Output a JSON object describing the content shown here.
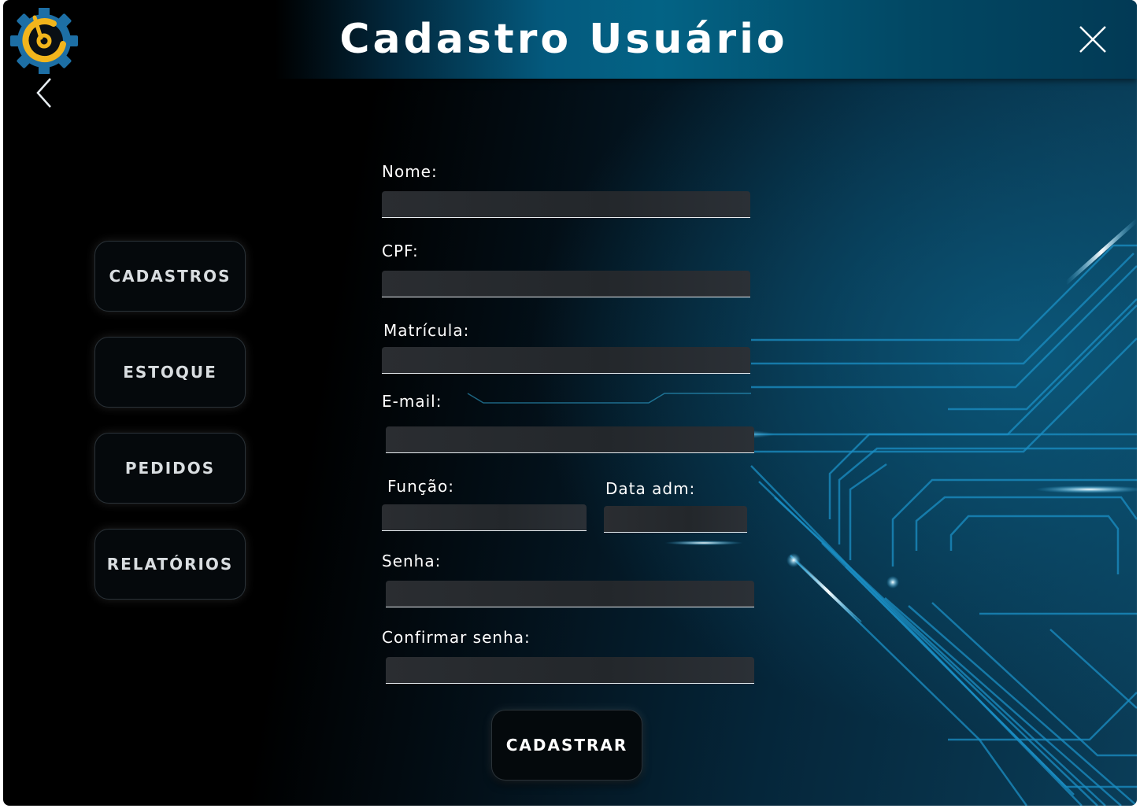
{
  "header": {
    "title": "Cadastro Usuário",
    "logo_icon": "gear-logo-icon",
    "back_icon": "chevron-left-icon",
    "close_icon": "close-icon"
  },
  "sidebar": {
    "items": [
      {
        "label": "CADASTROS"
      },
      {
        "label": "ESTOQUE"
      },
      {
        "label": "PEDIDOS"
      },
      {
        "label": "RELATÓRIOS"
      }
    ]
  },
  "form": {
    "nome": {
      "label": "Nome:",
      "value": ""
    },
    "cpf": {
      "label": "CPF:",
      "value": ""
    },
    "matricula": {
      "label": "Matrícula:",
      "value": ""
    },
    "email": {
      "label": "E-mail:",
      "value": ""
    },
    "funcao": {
      "label": "Função:",
      "value": ""
    },
    "data_adm": {
      "label": "Data adm:",
      "value": ""
    },
    "senha": {
      "label": "Senha:",
      "value": ""
    },
    "confirmar_senha": {
      "label": "Confirmar senha:",
      "value": ""
    },
    "submit_label": "CADASTRAR"
  },
  "colors": {
    "accent_blue": "#0a5f86",
    "logo_gear": "#1d6fa5",
    "logo_ring": "#f2b51c",
    "button_bg": "#05090c",
    "text": "#ffffff"
  }
}
